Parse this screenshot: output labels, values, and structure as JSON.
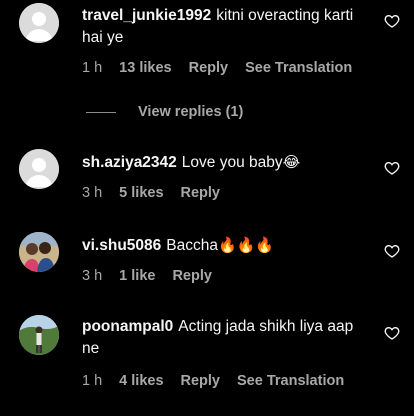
{
  "comments": [
    {
      "username": "travel_junkie1992",
      "text": "kitni overacting karti hai ye",
      "emoji": "",
      "time": "1 h",
      "likes": "13 likes",
      "reply": "Reply",
      "translate": "See Translation",
      "avatar": "default-avatar"
    },
    {
      "username": "sh.aziya2342",
      "text": "Love you baby",
      "emoji": "😂",
      "time": "3 h",
      "likes": "5 likes",
      "reply": "Reply",
      "translate": "",
      "avatar": "default-avatar"
    },
    {
      "username": "vi.shu5086",
      "text": "Baccha",
      "emoji": "🔥🔥🔥",
      "time": "3 h",
      "likes": "1 like",
      "reply": "Reply",
      "translate": "",
      "avatar": "photo-avatar"
    },
    {
      "username": "poonampal0",
      "text": "Acting jada shikh liya aap ne",
      "emoji": "",
      "time": "1 h",
      "likes": "4 likes",
      "reply": "Reply",
      "translate": "See Translation",
      "avatar": "photo-avatar"
    }
  ],
  "view_replies": "View replies (1)",
  "colors": {
    "background": "#000000",
    "text": "#f5f5f5",
    "muted": "#a8a8a8"
  }
}
